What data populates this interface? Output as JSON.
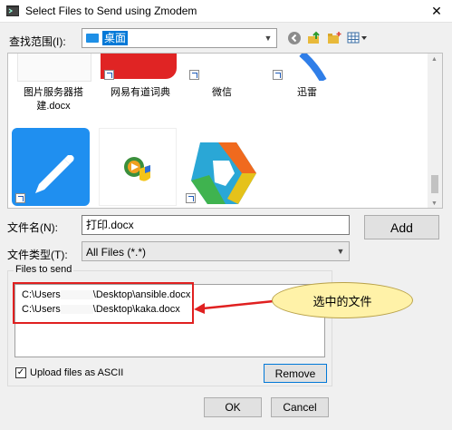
{
  "window": {
    "title": "Select Files to Send using Zmodem",
    "close_glyph": "✕"
  },
  "lookin": {
    "label": "查找范围(I):",
    "value": "桌面"
  },
  "toolbar": {
    "icons": [
      "back-icon",
      "up-folder-icon",
      "new-folder-icon",
      "view-menu-icon"
    ]
  },
  "files": [
    {
      "label": "图片服务器搭建.docx"
    },
    {
      "label": "网易有道词典"
    },
    {
      "label": "微信"
    },
    {
      "label": "迅雷"
    }
  ],
  "filename": {
    "label": "文件名(N):",
    "value": "打印.docx"
  },
  "filetype": {
    "label": "文件类型(T):",
    "value": "All Files (*.*)"
  },
  "add_button": "Add",
  "files_to_send": {
    "title": "Files to send",
    "items": [
      {
        "prefix": "C:\\Users",
        "suffix": "\\Desktop\\ansible.docx"
      },
      {
        "prefix": "C:\\Users",
        "suffix": "\\Desktop\\kaka.docx"
      }
    ],
    "ascii_label": "Upload files as ASCII",
    "ascii_checked": true,
    "ascii_check_glyph": "✓",
    "remove_label": "Remove"
  },
  "buttons": {
    "ok": "OK",
    "cancel": "Cancel"
  },
  "annotation": {
    "callout": "选中的文件"
  },
  "colors": {
    "accent": "#0078d7",
    "annotation_red": "#e02020",
    "callout_fill": "#fff2a8"
  }
}
